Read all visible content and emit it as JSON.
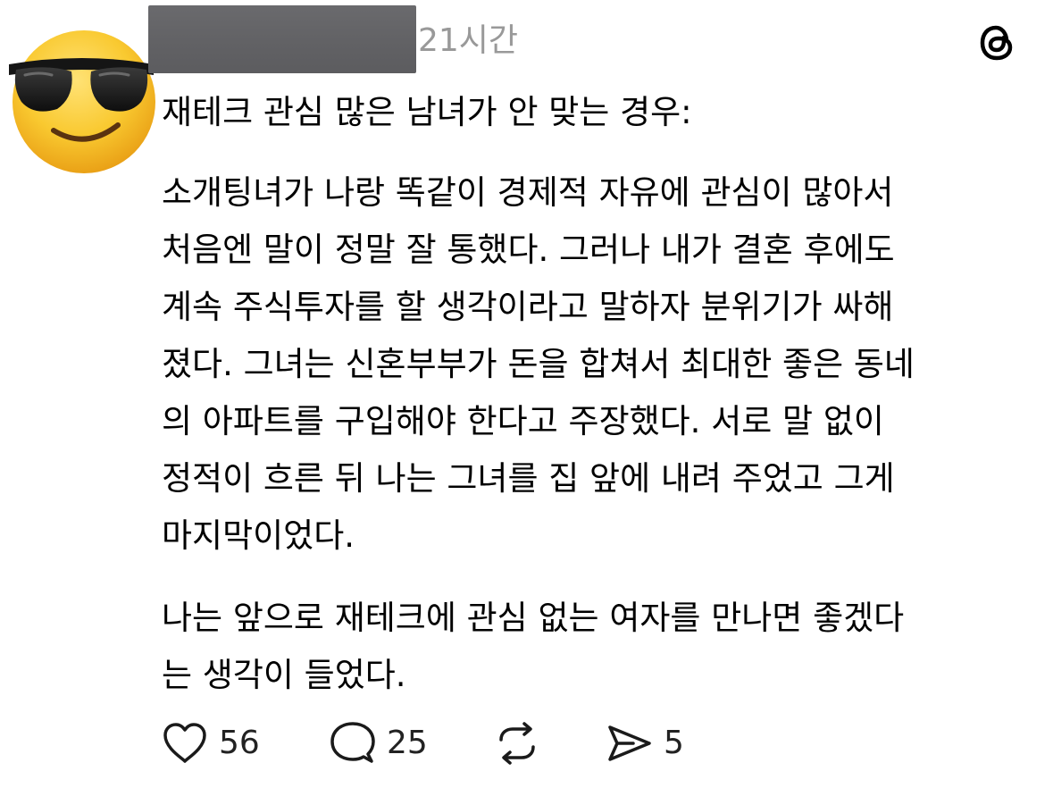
{
  "post": {
    "timestamp": "21시간",
    "heading": "재테크 관심 많은 남녀가 안 맞는 경우:",
    "paragraph1_lines": [
      "소개팅녀가 나랑 똑같이 경제적 자유에 관심이 많아서",
      "처음엔 말이 정말 잘 통했다. 그러나 내가 결혼 후에도",
      "계속 주식투자를 할 생각이라고 말하자 분위기가 싸해",
      "졌다. 그녀는 신혼부부가 돈을 합쳐서 최대한 좋은 동네",
      "의 아파트를 구입해야 한다고 주장했다. 서로 말 없이",
      "정적이 흐른 뒤 나는 그녀를 집 앞에 내려 주었고 그게",
      "마지막이었다."
    ],
    "paragraph2_lines": [
      "나는 앞으로 재테크에 관심 없는 여자를 만나면 좋겠다",
      "는 생각이 들었다."
    ]
  },
  "actions": {
    "like_count": "56",
    "reply_count": "25",
    "share_count": "5"
  },
  "icons": {
    "avatar": "sunglasses-emoji-icon",
    "app_logo": "threads-logo-icon",
    "like": "heart-icon",
    "reply": "speech-bubble-icon",
    "repost": "repost-arrows-icon",
    "share": "paper-plane-icon"
  },
  "colors": {
    "text": "#000000",
    "timestamp": "#999999",
    "redaction": "#666669",
    "emoji_face": "#f7c531"
  }
}
